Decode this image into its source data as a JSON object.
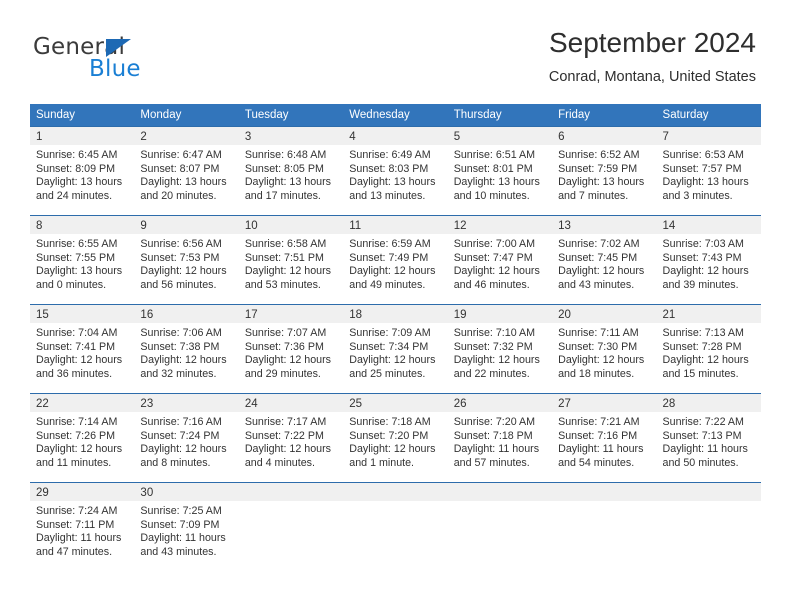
{
  "brand": {
    "name_part1": "General",
    "name_part2": "Blue",
    "triangle_color": "#1d69b4",
    "blue_color": "#1a7fd4"
  },
  "header": {
    "month_title": "September 2024",
    "location": "Conrad, Montana, United States"
  },
  "theme": {
    "header_blue": "#3275bb",
    "row_divider_blue": "#2d6cab",
    "day_band_gray": "#f0f0f0"
  },
  "calendar": {
    "weekdays": [
      "Sunday",
      "Monday",
      "Tuesday",
      "Wednesday",
      "Thursday",
      "Friday",
      "Saturday"
    ],
    "weeks": [
      [
        {
          "day": "1",
          "sunrise": "Sunrise: 6:45 AM",
          "sunset": "Sunset: 8:09 PM",
          "daylight1": "Daylight: 13 hours",
          "daylight2": "and 24 minutes."
        },
        {
          "day": "2",
          "sunrise": "Sunrise: 6:47 AM",
          "sunset": "Sunset: 8:07 PM",
          "daylight1": "Daylight: 13 hours",
          "daylight2": "and 20 minutes."
        },
        {
          "day": "3",
          "sunrise": "Sunrise: 6:48 AM",
          "sunset": "Sunset: 8:05 PM",
          "daylight1": "Daylight: 13 hours",
          "daylight2": "and 17 minutes."
        },
        {
          "day": "4",
          "sunrise": "Sunrise: 6:49 AM",
          "sunset": "Sunset: 8:03 PM",
          "daylight1": "Daylight: 13 hours",
          "daylight2": "and 13 minutes."
        },
        {
          "day": "5",
          "sunrise": "Sunrise: 6:51 AM",
          "sunset": "Sunset: 8:01 PM",
          "daylight1": "Daylight: 13 hours",
          "daylight2": "and 10 minutes."
        },
        {
          "day": "6",
          "sunrise": "Sunrise: 6:52 AM",
          "sunset": "Sunset: 7:59 PM",
          "daylight1": "Daylight: 13 hours",
          "daylight2": "and 7 minutes."
        },
        {
          "day": "7",
          "sunrise": "Sunrise: 6:53 AM",
          "sunset": "Sunset: 7:57 PM",
          "daylight1": "Daylight: 13 hours",
          "daylight2": "and 3 minutes."
        }
      ],
      [
        {
          "day": "8",
          "sunrise": "Sunrise: 6:55 AM",
          "sunset": "Sunset: 7:55 PM",
          "daylight1": "Daylight: 13 hours",
          "daylight2": "and 0 minutes."
        },
        {
          "day": "9",
          "sunrise": "Sunrise: 6:56 AM",
          "sunset": "Sunset: 7:53 PM",
          "daylight1": "Daylight: 12 hours",
          "daylight2": "and 56 minutes."
        },
        {
          "day": "10",
          "sunrise": "Sunrise: 6:58 AM",
          "sunset": "Sunset: 7:51 PM",
          "daylight1": "Daylight: 12 hours",
          "daylight2": "and 53 minutes."
        },
        {
          "day": "11",
          "sunrise": "Sunrise: 6:59 AM",
          "sunset": "Sunset: 7:49 PM",
          "daylight1": "Daylight: 12 hours",
          "daylight2": "and 49 minutes."
        },
        {
          "day": "12",
          "sunrise": "Sunrise: 7:00 AM",
          "sunset": "Sunset: 7:47 PM",
          "daylight1": "Daylight: 12 hours",
          "daylight2": "and 46 minutes."
        },
        {
          "day": "13",
          "sunrise": "Sunrise: 7:02 AM",
          "sunset": "Sunset: 7:45 PM",
          "daylight1": "Daylight: 12 hours",
          "daylight2": "and 43 minutes."
        },
        {
          "day": "14",
          "sunrise": "Sunrise: 7:03 AM",
          "sunset": "Sunset: 7:43 PM",
          "daylight1": "Daylight: 12 hours",
          "daylight2": "and 39 minutes."
        }
      ],
      [
        {
          "day": "15",
          "sunrise": "Sunrise: 7:04 AM",
          "sunset": "Sunset: 7:41 PM",
          "daylight1": "Daylight: 12 hours",
          "daylight2": "and 36 minutes."
        },
        {
          "day": "16",
          "sunrise": "Sunrise: 7:06 AM",
          "sunset": "Sunset: 7:38 PM",
          "daylight1": "Daylight: 12 hours",
          "daylight2": "and 32 minutes."
        },
        {
          "day": "17",
          "sunrise": "Sunrise: 7:07 AM",
          "sunset": "Sunset: 7:36 PM",
          "daylight1": "Daylight: 12 hours",
          "daylight2": "and 29 minutes."
        },
        {
          "day": "18",
          "sunrise": "Sunrise: 7:09 AM",
          "sunset": "Sunset: 7:34 PM",
          "daylight1": "Daylight: 12 hours",
          "daylight2": "and 25 minutes."
        },
        {
          "day": "19",
          "sunrise": "Sunrise: 7:10 AM",
          "sunset": "Sunset: 7:32 PM",
          "daylight1": "Daylight: 12 hours",
          "daylight2": "and 22 minutes."
        },
        {
          "day": "20",
          "sunrise": "Sunrise: 7:11 AM",
          "sunset": "Sunset: 7:30 PM",
          "daylight1": "Daylight: 12 hours",
          "daylight2": "and 18 minutes."
        },
        {
          "day": "21",
          "sunrise": "Sunrise: 7:13 AM",
          "sunset": "Sunset: 7:28 PM",
          "daylight1": "Daylight: 12 hours",
          "daylight2": "and 15 minutes."
        }
      ],
      [
        {
          "day": "22",
          "sunrise": "Sunrise: 7:14 AM",
          "sunset": "Sunset: 7:26 PM",
          "daylight1": "Daylight: 12 hours",
          "daylight2": "and 11 minutes."
        },
        {
          "day": "23",
          "sunrise": "Sunrise: 7:16 AM",
          "sunset": "Sunset: 7:24 PM",
          "daylight1": "Daylight: 12 hours",
          "daylight2": "and 8 minutes."
        },
        {
          "day": "24",
          "sunrise": "Sunrise: 7:17 AM",
          "sunset": "Sunset: 7:22 PM",
          "daylight1": "Daylight: 12 hours",
          "daylight2": "and 4 minutes."
        },
        {
          "day": "25",
          "sunrise": "Sunrise: 7:18 AM",
          "sunset": "Sunset: 7:20 PM",
          "daylight1": "Daylight: 12 hours",
          "daylight2": "and 1 minute."
        },
        {
          "day": "26",
          "sunrise": "Sunrise: 7:20 AM",
          "sunset": "Sunset: 7:18 PM",
          "daylight1": "Daylight: 11 hours",
          "daylight2": "and 57 minutes."
        },
        {
          "day": "27",
          "sunrise": "Sunrise: 7:21 AM",
          "sunset": "Sunset: 7:16 PM",
          "daylight1": "Daylight: 11 hours",
          "daylight2": "and 54 minutes."
        },
        {
          "day": "28",
          "sunrise": "Sunrise: 7:22 AM",
          "sunset": "Sunset: 7:13 PM",
          "daylight1": "Daylight: 11 hours",
          "daylight2": "and 50 minutes."
        }
      ],
      [
        {
          "day": "29",
          "sunrise": "Sunrise: 7:24 AM",
          "sunset": "Sunset: 7:11 PM",
          "daylight1": "Daylight: 11 hours",
          "daylight2": "and 47 minutes."
        },
        {
          "day": "30",
          "sunrise": "Sunrise: 7:25 AM",
          "sunset": "Sunset: 7:09 PM",
          "daylight1": "Daylight: 11 hours",
          "daylight2": "and 43 minutes."
        },
        {
          "day": "",
          "sunrise": "",
          "sunset": "",
          "daylight1": "",
          "daylight2": ""
        },
        {
          "day": "",
          "sunrise": "",
          "sunset": "",
          "daylight1": "",
          "daylight2": ""
        },
        {
          "day": "",
          "sunrise": "",
          "sunset": "",
          "daylight1": "",
          "daylight2": ""
        },
        {
          "day": "",
          "sunrise": "",
          "sunset": "",
          "daylight1": "",
          "daylight2": ""
        },
        {
          "day": "",
          "sunrise": "",
          "sunset": "",
          "daylight1": "",
          "daylight2": ""
        }
      ]
    ]
  }
}
